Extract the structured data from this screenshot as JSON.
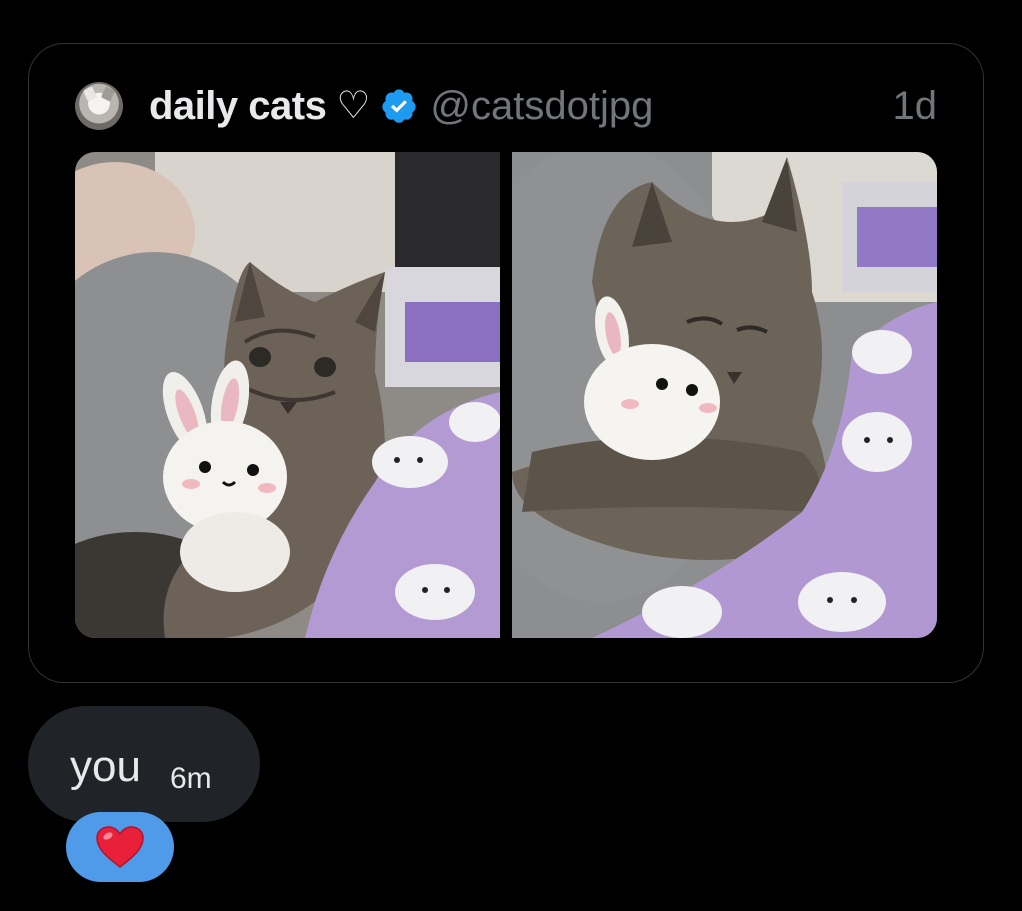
{
  "quoted_tweet": {
    "author": {
      "display_name": "daily cats",
      "name_suffix_symbol": "♡",
      "handle": "@catsdotjpg",
      "verified": true,
      "verified_color": "#1d9bf0"
    },
    "timestamp": "1d",
    "media": [
      {
        "description_icon": "photo-cat-with-bunny-plush"
      },
      {
        "description_icon": "photo-cat-sleeping-with-bunny-plush"
      }
    ]
  },
  "message": {
    "text": "you",
    "time": "6m",
    "reaction": {
      "emoji_name": "red-heart-emoji",
      "bubble_color": "#4f9bea"
    }
  },
  "colors": {
    "background": "#000000",
    "card_border": "#2f3336",
    "bubble": "#202327",
    "muted_text": "#71767b",
    "primary_text": "#e7e9ea"
  }
}
